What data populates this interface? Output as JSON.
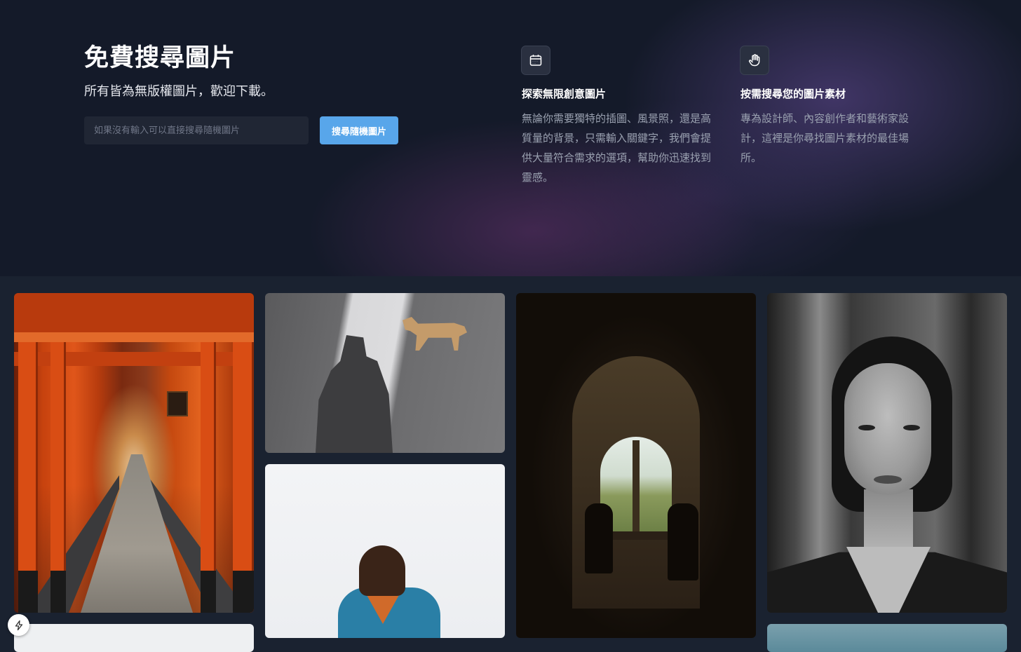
{
  "hero": {
    "title": "免費搜尋圖片",
    "subtitle": "所有皆為無版權圖片，歡迎下載。",
    "search": {
      "placeholder": "如果沒有輸入可以直接搜尋隨機圖片",
      "value": "",
      "button_label": "搜尋隨機圖片"
    }
  },
  "features": [
    {
      "icon": "calendar-icon",
      "title": "探索無限創意圖片",
      "description": "無論你需要獨特的插圖、風景照，還是高質量的背景，只需輸入關鍵字，我們會提供大量符合需求的選項，幫助你迅速找到靈感。"
    },
    {
      "icon": "hand-icon",
      "title": "按需搜尋您的圖片素材",
      "description": "專為設計師、內容創作者和藝術家設計，這裡是你尋找圖片素材的最佳場所。"
    }
  ],
  "gallery": {
    "photos": [
      {
        "subject": "torii-gates-tunnel"
      },
      {
        "subject": "shadow-and-dog"
      },
      {
        "subject": "arched-window-silhouettes"
      },
      {
        "subject": "black-and-white-portrait"
      },
      {
        "subject": "woman-in-blue-coat"
      },
      {
        "subject": "partial-light-photo"
      },
      {
        "subject": "partial-teal-photo"
      }
    ]
  },
  "colors": {
    "hero_background": "#141a29",
    "gallery_background": "#1a2230",
    "accent": "#58a6ea",
    "text_primary": "#ffffff",
    "text_muted": "#9aa1b0"
  },
  "floating_action": {
    "icon": "lightning-icon"
  }
}
